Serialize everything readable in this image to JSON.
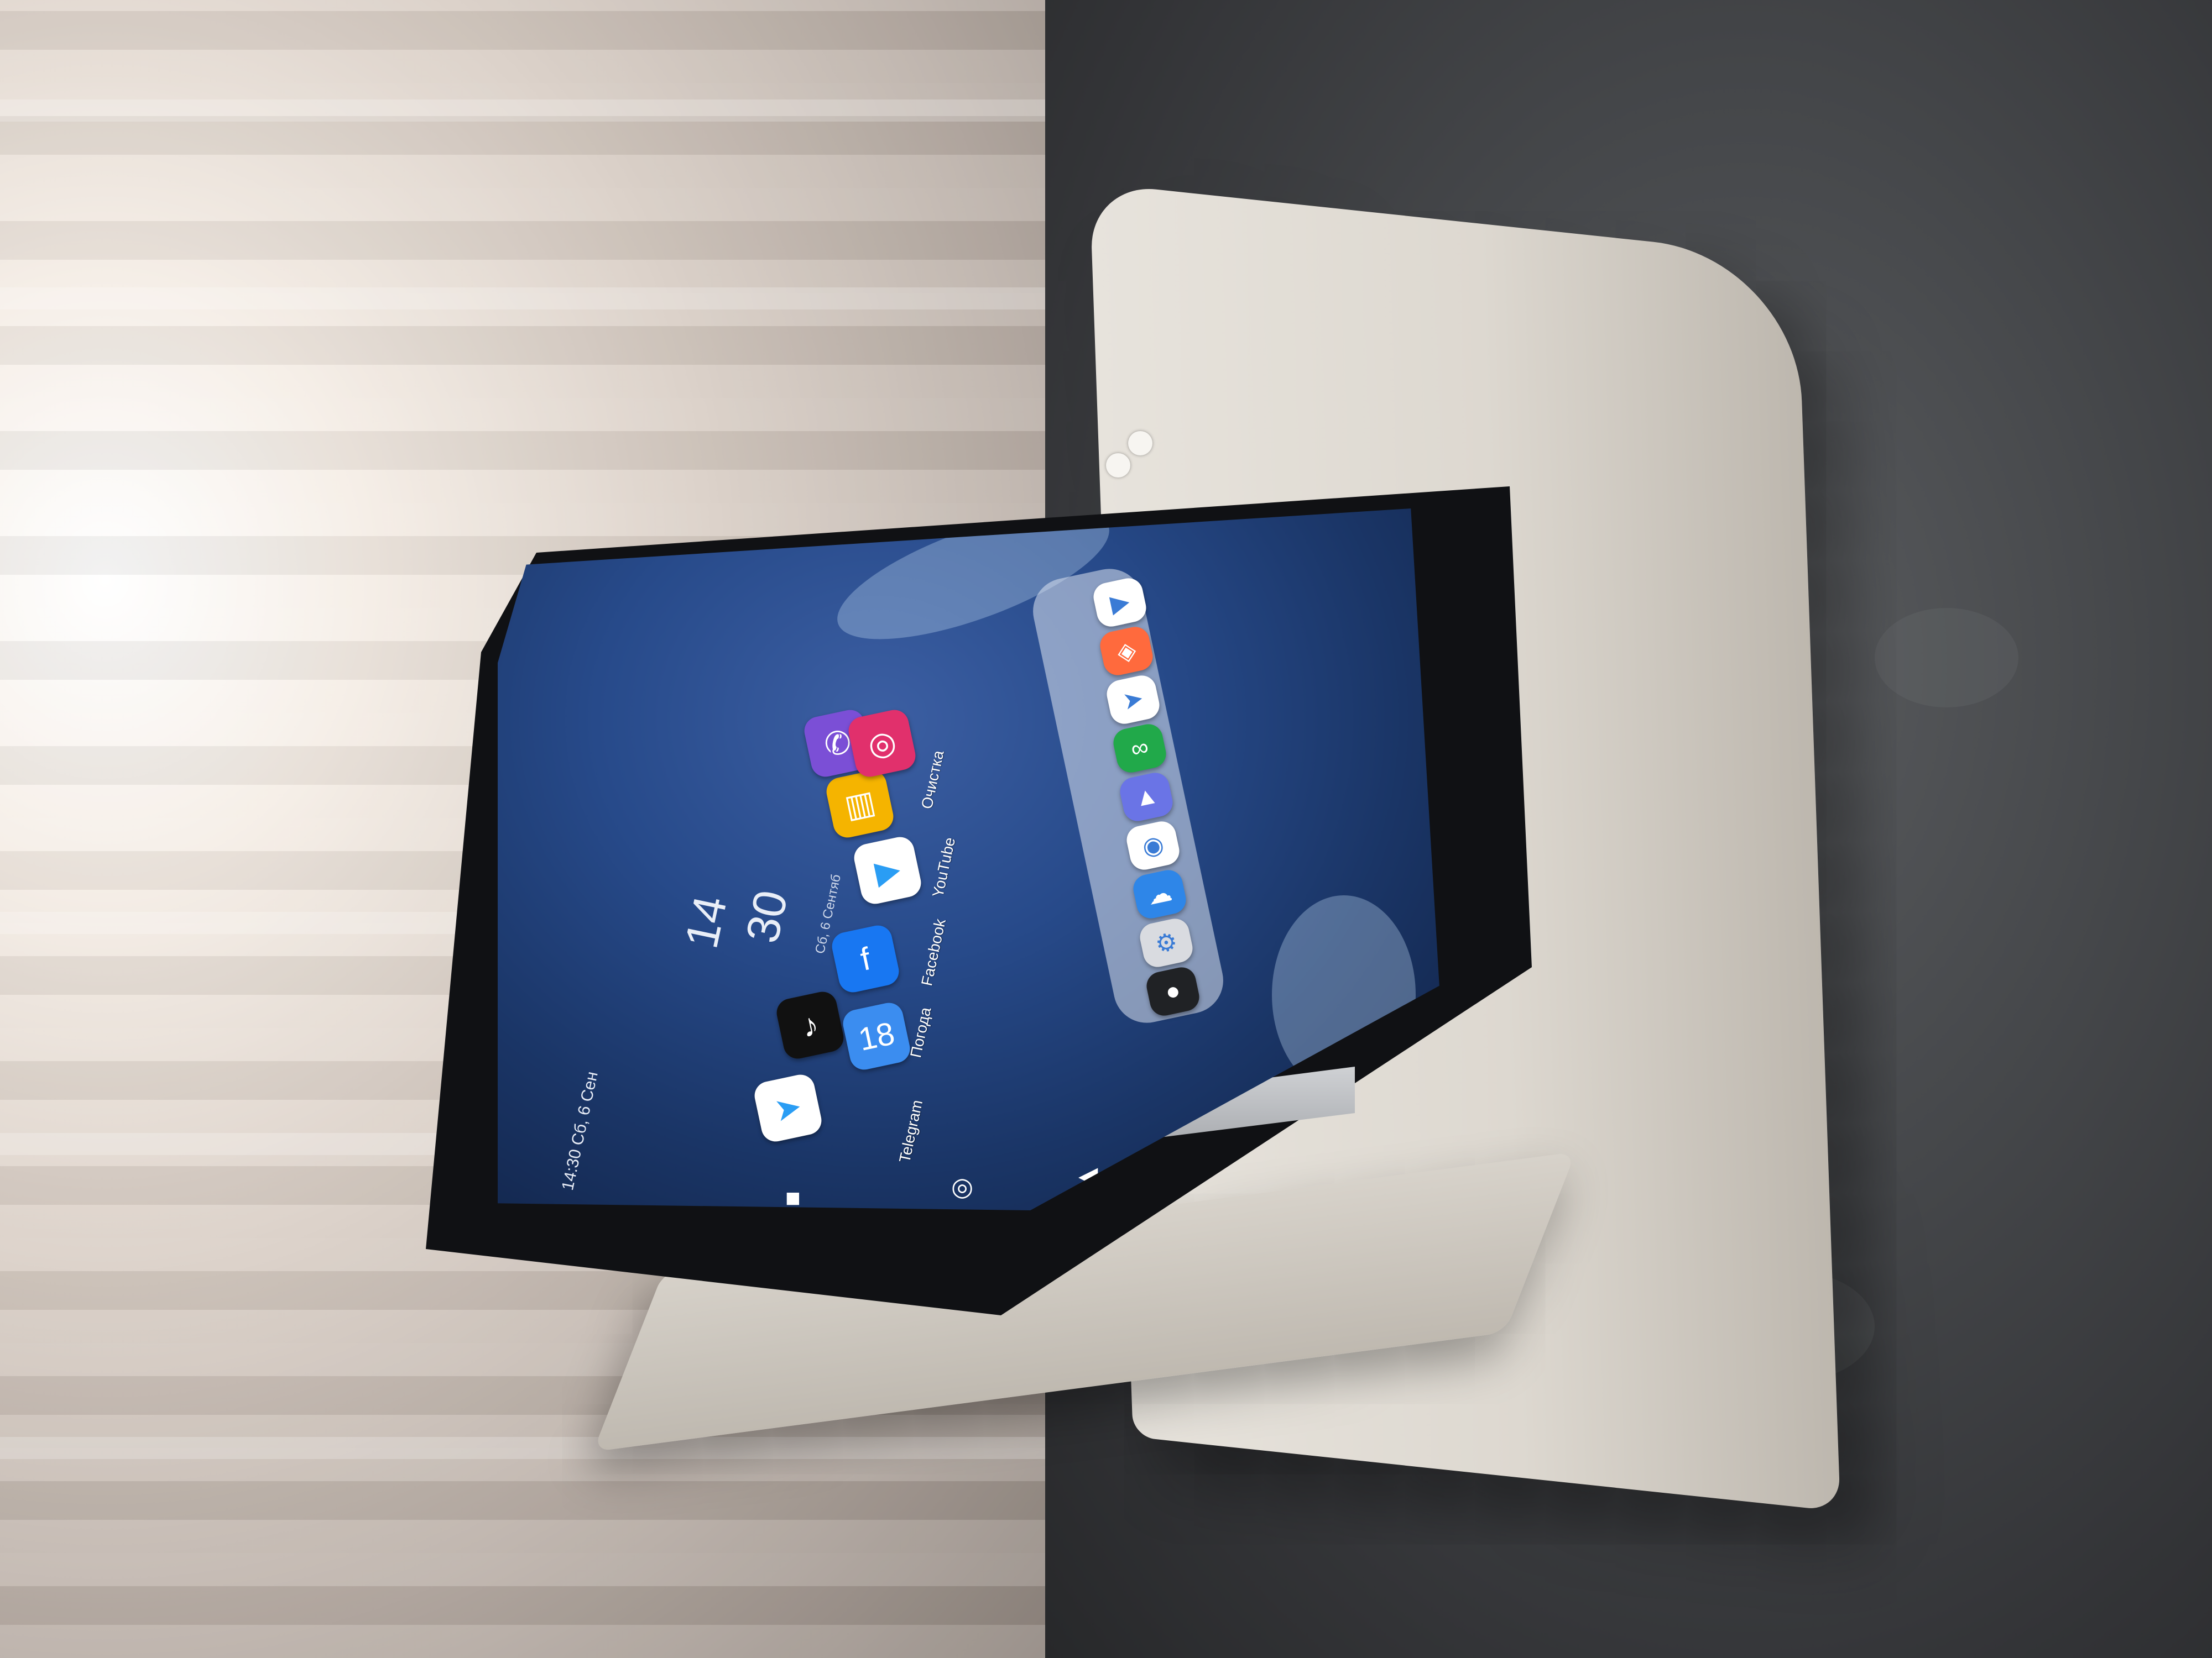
{
  "tablet_screen": {
    "clock_hour": "14",
    "clock_minute": "30",
    "clock_date": "Сб, 6 Сентяб",
    "status_bar": "14:30 Сб, 6 Сен",
    "apps": [
      {
        "label": "Telegram",
        "icon": "telegram-icon",
        "color": "#ffffff",
        "glyph": "➤"
      },
      {
        "label": "",
        "icon": "tiktok-icon",
        "color": "#111111",
        "glyph": "♪"
      },
      {
        "label": "Погода",
        "icon": "weather-icon",
        "color": "#3b8df0",
        "glyph": "18"
      },
      {
        "label": "Facebook",
        "icon": "facebook-icon",
        "color": "#1877f2",
        "glyph": "f"
      },
      {
        "label": "YouTube",
        "icon": "youtube-icon",
        "color": "#ffffff",
        "glyph": "▶"
      },
      {
        "label": "Очистка",
        "icon": "cleaner-icon",
        "color": "#f5b400",
        "glyph": "▥"
      },
      {
        "label": "",
        "icon": "viber-icon",
        "color": "#7b4fd6",
        "glyph": "✆"
      },
      {
        "label": "",
        "icon": "instagram-icon",
        "color": "#e1306c",
        "glyph": "◎"
      }
    ],
    "dock": [
      {
        "icon": "youtube-icon",
        "color": "#ffffff",
        "glyph": "▶"
      },
      {
        "icon": "app-store-icon",
        "color": "#ff6a3d",
        "glyph": "◈"
      },
      {
        "icon": "telegram-icon",
        "color": "#ffffff",
        "glyph": "➤"
      },
      {
        "icon": "messages-icon",
        "color": "#21a94a",
        "glyph": "∞"
      },
      {
        "icon": "gallery-icon",
        "color": "#6a74e6",
        "glyph": "▲"
      },
      {
        "icon": "chrome-icon",
        "color": "#ffffff",
        "glyph": "◉"
      },
      {
        "icon": "notes-icon",
        "color": "#2e86e8",
        "glyph": "☁"
      },
      {
        "icon": "settings-icon",
        "color": "#d9dbe0",
        "glyph": "⚙"
      },
      {
        "icon": "camera-icon",
        "color": "#202225",
        "glyph": "●"
      }
    ],
    "nav": [
      "◀",
      "◎",
      "■"
    ]
  }
}
